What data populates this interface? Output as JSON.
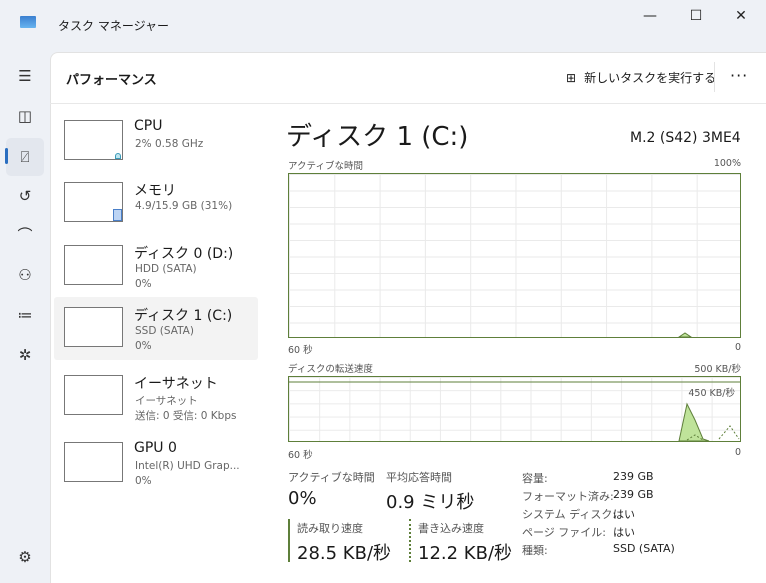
{
  "window": {
    "title": "タスク マネージャー",
    "minimize": "—",
    "maximize": "☐",
    "close": "✕"
  },
  "nav": [
    "menu-icon",
    "processes-icon",
    "performance-icon",
    "history-icon",
    "startup-icon",
    "users-icon",
    "details-icon",
    "services-icon",
    "settings-icon"
  ],
  "header": {
    "title": "パフォーマンス",
    "new_task": "新しいタスクを実行する",
    "more": "···"
  },
  "devices": [
    {
      "name": "CPU",
      "sub1": "2%  0.58 GHz",
      "sub2": ""
    },
    {
      "name": "メモリ",
      "sub1": "4.9/15.9 GB (31%)",
      "sub2": ""
    },
    {
      "name": "ディスク 0 (D:)",
      "sub1": "HDD (SATA)",
      "sub2": "0%"
    },
    {
      "name": "ディスク 1 (C:)",
      "sub1": "SSD (SATA)",
      "sub2": "0%"
    },
    {
      "name": "イーサネット",
      "sub1": "イーサネット",
      "sub2": "送信: 0 受信: 0 Kbps"
    },
    {
      "name": "GPU 0",
      "sub1": "Intel(R) UHD Grap...",
      "sub2": "0%"
    }
  ],
  "detail": {
    "title": "ディスク 1 (C:)",
    "model": "M.2 (S42) 3ME4",
    "chart1": {
      "label": "アクティブな時間",
      "max": "100%",
      "xleft": "60 秒",
      "xright": "0"
    },
    "chart2": {
      "label": "ディスクの転送速度",
      "max": "500 KB/秒",
      "peak": "450 KB/秒",
      "xleft": "60 秒",
      "xright": "0"
    },
    "active_label": "アクティブな時間",
    "active_value": "0%",
    "resp_label": "平均応答時間",
    "resp_value": "0.9 ミリ秒",
    "read_label": "読み取り速度",
    "read_value": "28.5 KB/秒",
    "write_label": "書き込み速度",
    "write_value": "12.2 KB/秒",
    "props": [
      {
        "k": "容量:",
        "v": "239 GB"
      },
      {
        "k": "フォーマット済み:",
        "v": "239 GB"
      },
      {
        "k": "システム ディスク:",
        "v": "はい"
      },
      {
        "k": "ページ ファイル:",
        "v": "はい"
      },
      {
        "k": "種類:",
        "v": "SSD (SATA)"
      }
    ]
  },
  "colors": {
    "accent": "#2a6ec0",
    "disk": "#5e7f3a",
    "disk_fill": "#bfe39a"
  }
}
